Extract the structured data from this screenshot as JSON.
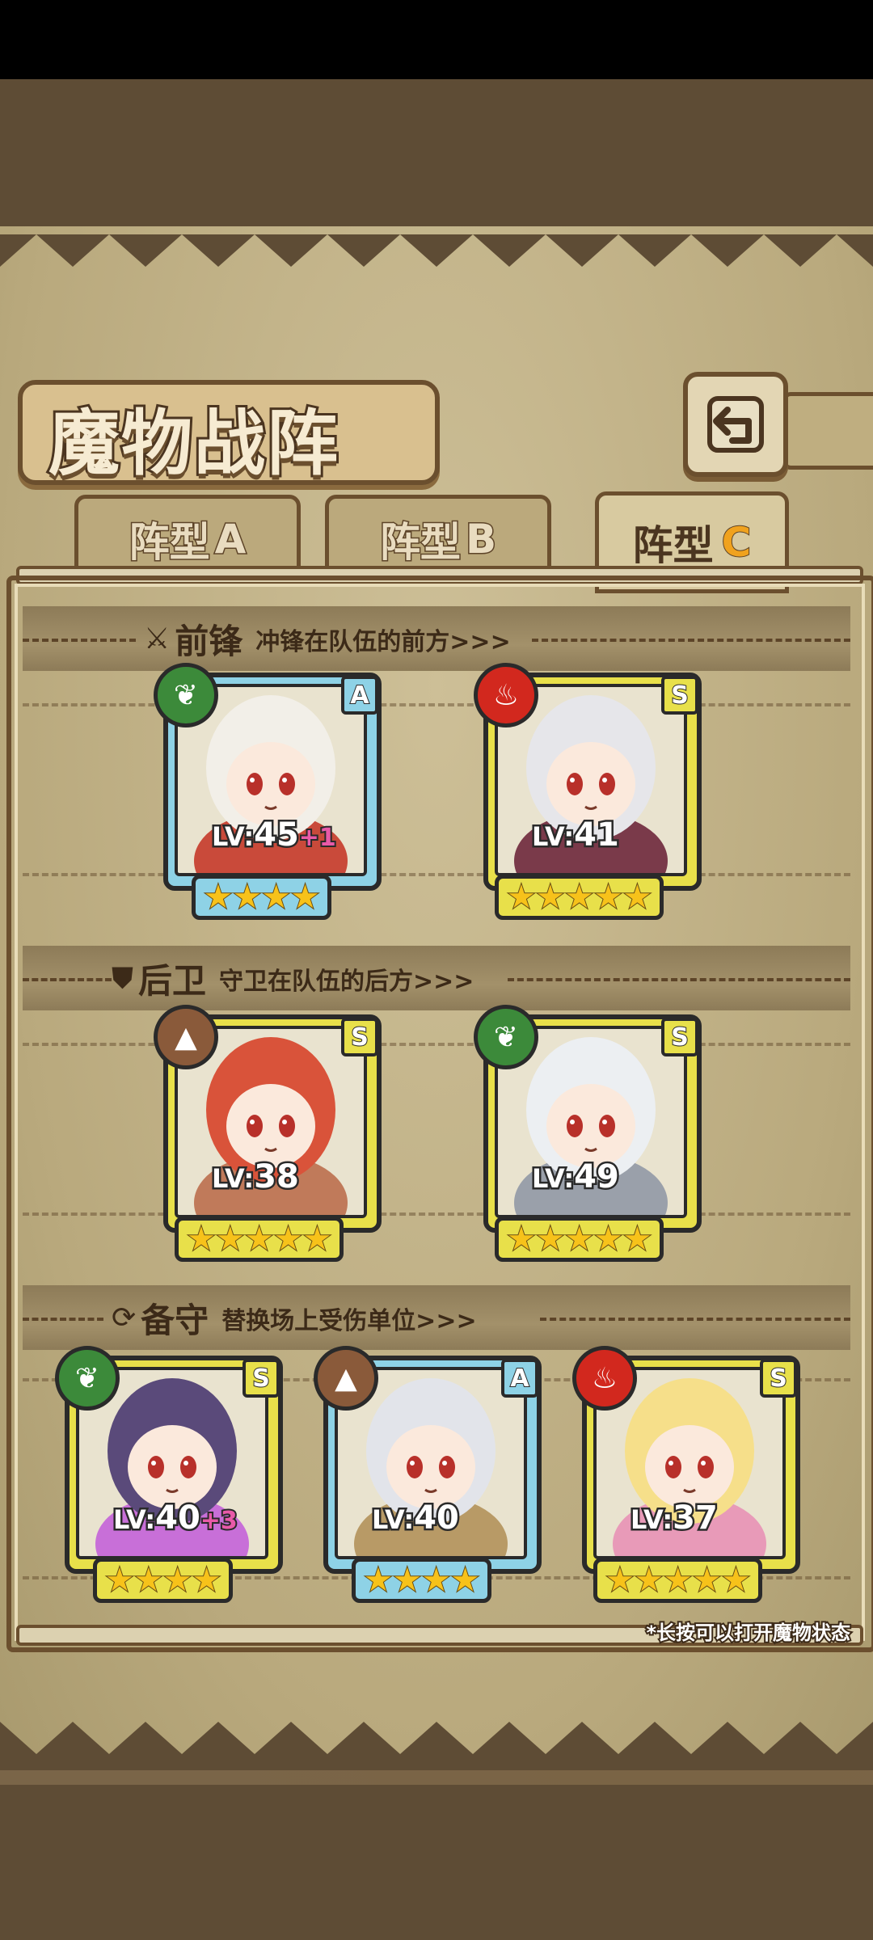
{
  "screen": {
    "title": "魔物战阵",
    "back_icon": "back-arrow-icon",
    "hint": "*长按可以打开魔物状态"
  },
  "tabs": [
    {
      "label_main": "阵型",
      "label_letter": "A",
      "active": false
    },
    {
      "label_main": "阵型",
      "label_letter": "B",
      "active": false
    },
    {
      "label_main": "阵型",
      "label_letter": "C",
      "active": true
    }
  ],
  "sections": [
    {
      "key": "front",
      "icon": "sword-icon",
      "title": "前锋",
      "desc": "冲锋在队伍的前方>>>"
    },
    {
      "key": "back",
      "icon": "shield-icon",
      "title": "后卫",
      "desc": "守卫在队伍的后方>>>"
    },
    {
      "key": "reserve",
      "icon": "swap-icon",
      "title": "备守",
      "desc": "替换场上受伤单位>>>"
    }
  ],
  "monsters": [
    {
      "slot": "front-1",
      "rank": "A",
      "element": "grass",
      "level_prefix": "LV:",
      "level": "45",
      "bonus": "+1",
      "stars": 4
    },
    {
      "slot": "front-2",
      "rank": "S",
      "element": "fire",
      "level_prefix": "LV:",
      "level": "41",
      "bonus": "",
      "stars": 5
    },
    {
      "slot": "back-1",
      "rank": "S",
      "element": "earth",
      "level_prefix": "LV:",
      "level": "38",
      "bonus": "",
      "stars": 5
    },
    {
      "slot": "back-2",
      "rank": "S",
      "element": "grass",
      "level_prefix": "LV:",
      "level": "49",
      "bonus": "",
      "stars": 5
    },
    {
      "slot": "reserve-1",
      "rank": "S",
      "element": "grass",
      "level_prefix": "LV:",
      "level": "40",
      "bonus": "+3",
      "stars": 4
    },
    {
      "slot": "reserve-2",
      "rank": "A",
      "element": "earth",
      "level_prefix": "LV:",
      "level": "40",
      "bonus": "",
      "stars": 4
    },
    {
      "slot": "reserve-3",
      "rank": "S",
      "element": "fire",
      "level_prefix": "LV:",
      "level": "37",
      "bonus": "",
      "stars": 5
    }
  ],
  "colors": {
    "rank_S": "#e8e04a",
    "rank_A": "#8ed2e6",
    "element_grass": "#3c8a3a",
    "element_fire": "#d2281e",
    "element_earth": "#8a5a3a",
    "bonus": "#e85aa8",
    "tab_active_accent": "#f0a21e"
  }
}
